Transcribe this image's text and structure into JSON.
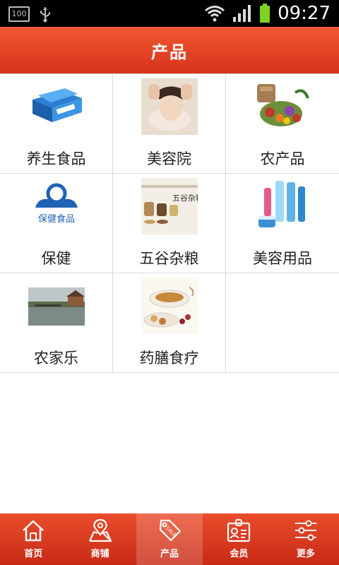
{
  "status_bar": {
    "battery_left": "100",
    "time": "09:27"
  },
  "header": {
    "title": "产品"
  },
  "grid": [
    {
      "label": "养生食品",
      "icon": "health-food-box-image"
    },
    {
      "label": "美容院",
      "icon": "beauty-salon-image"
    },
    {
      "label": "农产品",
      "icon": "farm-produce-image"
    },
    {
      "label": "保健",
      "icon": "health-care-logo-image",
      "logo_text": "保健食品"
    },
    {
      "label": "五谷杂粮",
      "icon": "grains-image",
      "image_text": "五谷杂粮"
    },
    {
      "label": "美容用品",
      "icon": "cosmetics-image"
    },
    {
      "label": "农家乐",
      "icon": "farmhouse-lake-image"
    },
    {
      "label": "药膳食疗",
      "icon": "herbal-tea-image"
    }
  ],
  "tabbar": [
    {
      "label": "首页",
      "icon": "home-icon",
      "active": false
    },
    {
      "label": "商铺",
      "icon": "shop-map-icon",
      "active": false
    },
    {
      "label": "产品",
      "icon": "sale-tag-icon",
      "active": true,
      "icon_text": "SALE"
    },
    {
      "label": "会员",
      "icon": "member-card-icon",
      "active": false
    },
    {
      "label": "更多",
      "icon": "settings-sliders-icon",
      "active": false
    }
  ],
  "colors": {
    "accent": "#e0401f",
    "header_top": "#f05a33",
    "header_bottom": "#d8321b"
  }
}
